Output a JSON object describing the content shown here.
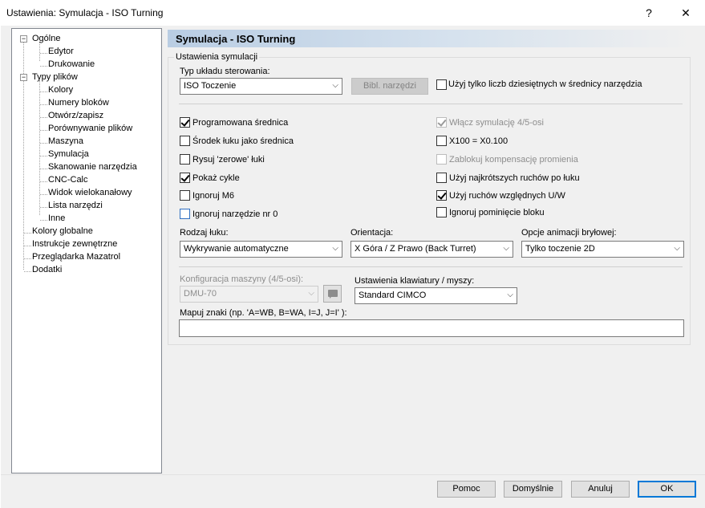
{
  "window": {
    "title": "Ustawienia: Symulacja - ISO Turning",
    "help_label": "?",
    "close_label": "✕"
  },
  "tree": {
    "expander_open": "−",
    "items": [
      {
        "label": "Ogólne"
      },
      {
        "label": "Edytor"
      },
      {
        "label": "Drukowanie"
      },
      {
        "label": "Typy plików"
      },
      {
        "label": "Kolory"
      },
      {
        "label": "Numery bloków"
      },
      {
        "label": "Otwórz/zapisz"
      },
      {
        "label": "Porównywanie plików"
      },
      {
        "label": "Maszyna"
      },
      {
        "label": "Symulacja"
      },
      {
        "label": "Skanowanie narzędzia"
      },
      {
        "label": "CNC-Calc"
      },
      {
        "label": "Widok wielokanałowy"
      },
      {
        "label": "Lista narzędzi"
      },
      {
        "label": "Inne"
      },
      {
        "label": "Kolory globalne"
      },
      {
        "label": "Instrukcje zewnętrzne"
      },
      {
        "label": "Przeglądarka Mazatrol"
      },
      {
        "label": "Dodatki"
      }
    ]
  },
  "content": {
    "header": "Symulacja - ISO Turning",
    "group_title": "Ustawienia symulacji",
    "control_type_label": "Typ układu sterowania:",
    "control_type_value": "ISO Toczenie",
    "combo_arrow": "⌵",
    "tool_library_button": "Bibl. narzędzi",
    "only_decimal_label": "Użyj tylko liczb dziesiętnych w średnicy narzędzia",
    "checkboxes_left": [
      {
        "label": "Programowana średnica",
        "checked": true
      },
      {
        "label": "Środek łuku jako średnica",
        "checked": false
      },
      {
        "label": "Rysuj 'zerowe' łuki",
        "checked": false
      },
      {
        "label": "Pokaż cykle",
        "checked": true
      },
      {
        "label": "Ignoruj M6",
        "checked": false
      },
      {
        "label": "Ignoruj narzędzie nr 0",
        "checked": false
      }
    ],
    "checkboxes_right": [
      {
        "label": "Włącz symulację 4/5-osi",
        "checked": true
      },
      {
        "label": "X100 = X0.100",
        "checked": false
      },
      {
        "label": "Zablokuj kompensację promienia",
        "checked": false
      },
      {
        "label": "Użyj najkrótszych ruchów po łuku",
        "checked": false
      },
      {
        "label": "Użyj ruchów względnych U/W",
        "checked": true
      },
      {
        "label": "Ignoruj pominięcie bloku",
        "checked": false
      }
    ],
    "arc_type_label": "Rodzaj łuku:",
    "arc_type_value": "Wykrywanie automatyczne",
    "orientation_label": "Orientacja:",
    "orientation_value": "X Góra   / Z Prawo (Back Turret)",
    "solid_anim_label": "Opcje animacji bryłowej:",
    "solid_anim_value": "Tylko toczenie 2D",
    "machine_config_label": "Konfiguracja maszyny (4/5-osi):",
    "machine_config_value": "DMU-70",
    "keyboard_label": "Ustawienia klawiatury / myszy:",
    "keyboard_value": "Standard CIMCO",
    "map_chars_label": "Mapuj znaki (np. 'A=WB, B=WA, I=J, J=I' ):",
    "map_chars_value": ""
  },
  "buttons": {
    "help": "Pomoc",
    "defaults": "Domyślnie",
    "cancel": "Anuluj",
    "ok": "OK"
  }
}
